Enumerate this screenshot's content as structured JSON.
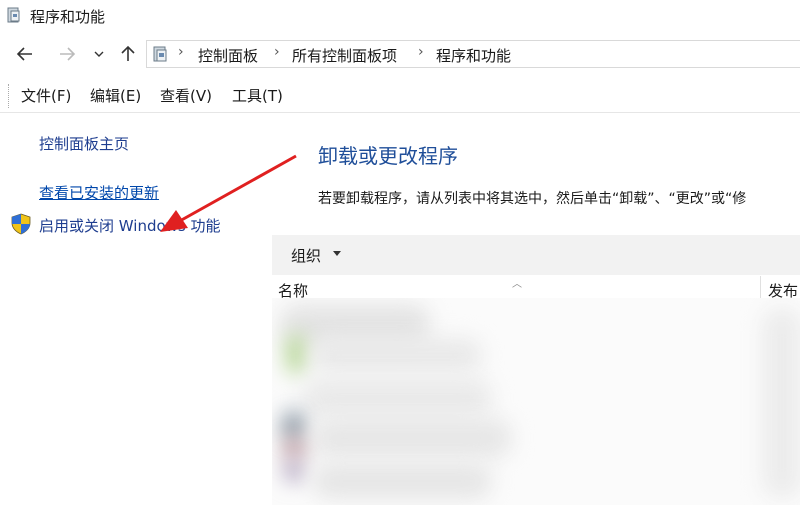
{
  "window": {
    "title": "程序和功能"
  },
  "nav": {
    "back_icon": "back-arrow-icon",
    "forward_icon": "forward-arrow-icon",
    "recent_icon": "chevron-down-icon",
    "up_icon": "up-arrow-icon"
  },
  "address": {
    "crumbs": [
      "控制面板",
      "所有控制面板项",
      "程序和功能"
    ]
  },
  "menu": {
    "items": [
      "文件(F)",
      "编辑(E)",
      "查看(V)",
      "工具(T)"
    ]
  },
  "sidebar": {
    "home": "控制面板主页",
    "updates": "查看已安装的更新",
    "features": "启用或关闭 Windows 功能"
  },
  "main": {
    "title": "卸载或更改程序",
    "instruction": "若要卸载程序，请从列表中将其选中，然后单击“卸载”、“更改”或“修",
    "organize": "组织",
    "columns": {
      "name": "名称",
      "publisher": "发布"
    }
  },
  "colors": {
    "link": "#1e3d8f",
    "title_blue": "#1f4e99",
    "annotation_arrow": "#e02020",
    "toolbar_bg": "#f2f2f2"
  }
}
